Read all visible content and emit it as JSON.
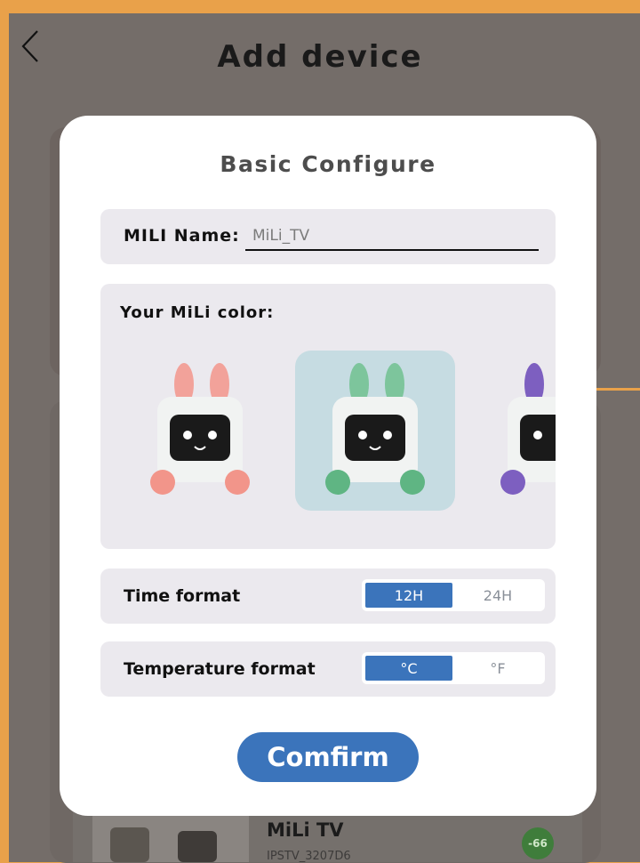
{
  "header": {
    "title": "Add device"
  },
  "modal": {
    "title": "Basic Configure",
    "name_label": "MILI Name:",
    "name_value": "MiLi_TV",
    "color_label": "Your MiLi color:",
    "colors": [
      {
        "name": "pink",
        "accent": "#f2a29a",
        "selected": false
      },
      {
        "name": "green",
        "accent": "#6fbf92",
        "selected": true
      },
      {
        "name": "purple",
        "accent": "#7d5fc0",
        "selected": false
      }
    ],
    "time_format": {
      "label": "Time format",
      "options": [
        "12H",
        "24H"
      ],
      "selected": "12H"
    },
    "temperature_format": {
      "label": "Temperature format",
      "options": [
        "°C",
        "°F"
      ],
      "selected": "°C"
    },
    "confirm_label": "Comfirm"
  },
  "device_list": [
    {
      "name": "MiLi TV",
      "id": "IPSTV_3207D6",
      "signal": "-66"
    }
  ],
  "colors": {
    "accent": "#3b74bb",
    "frame": "#e9a14a",
    "overlay_bg": "#746d69",
    "signal": "#3f7d3b"
  }
}
